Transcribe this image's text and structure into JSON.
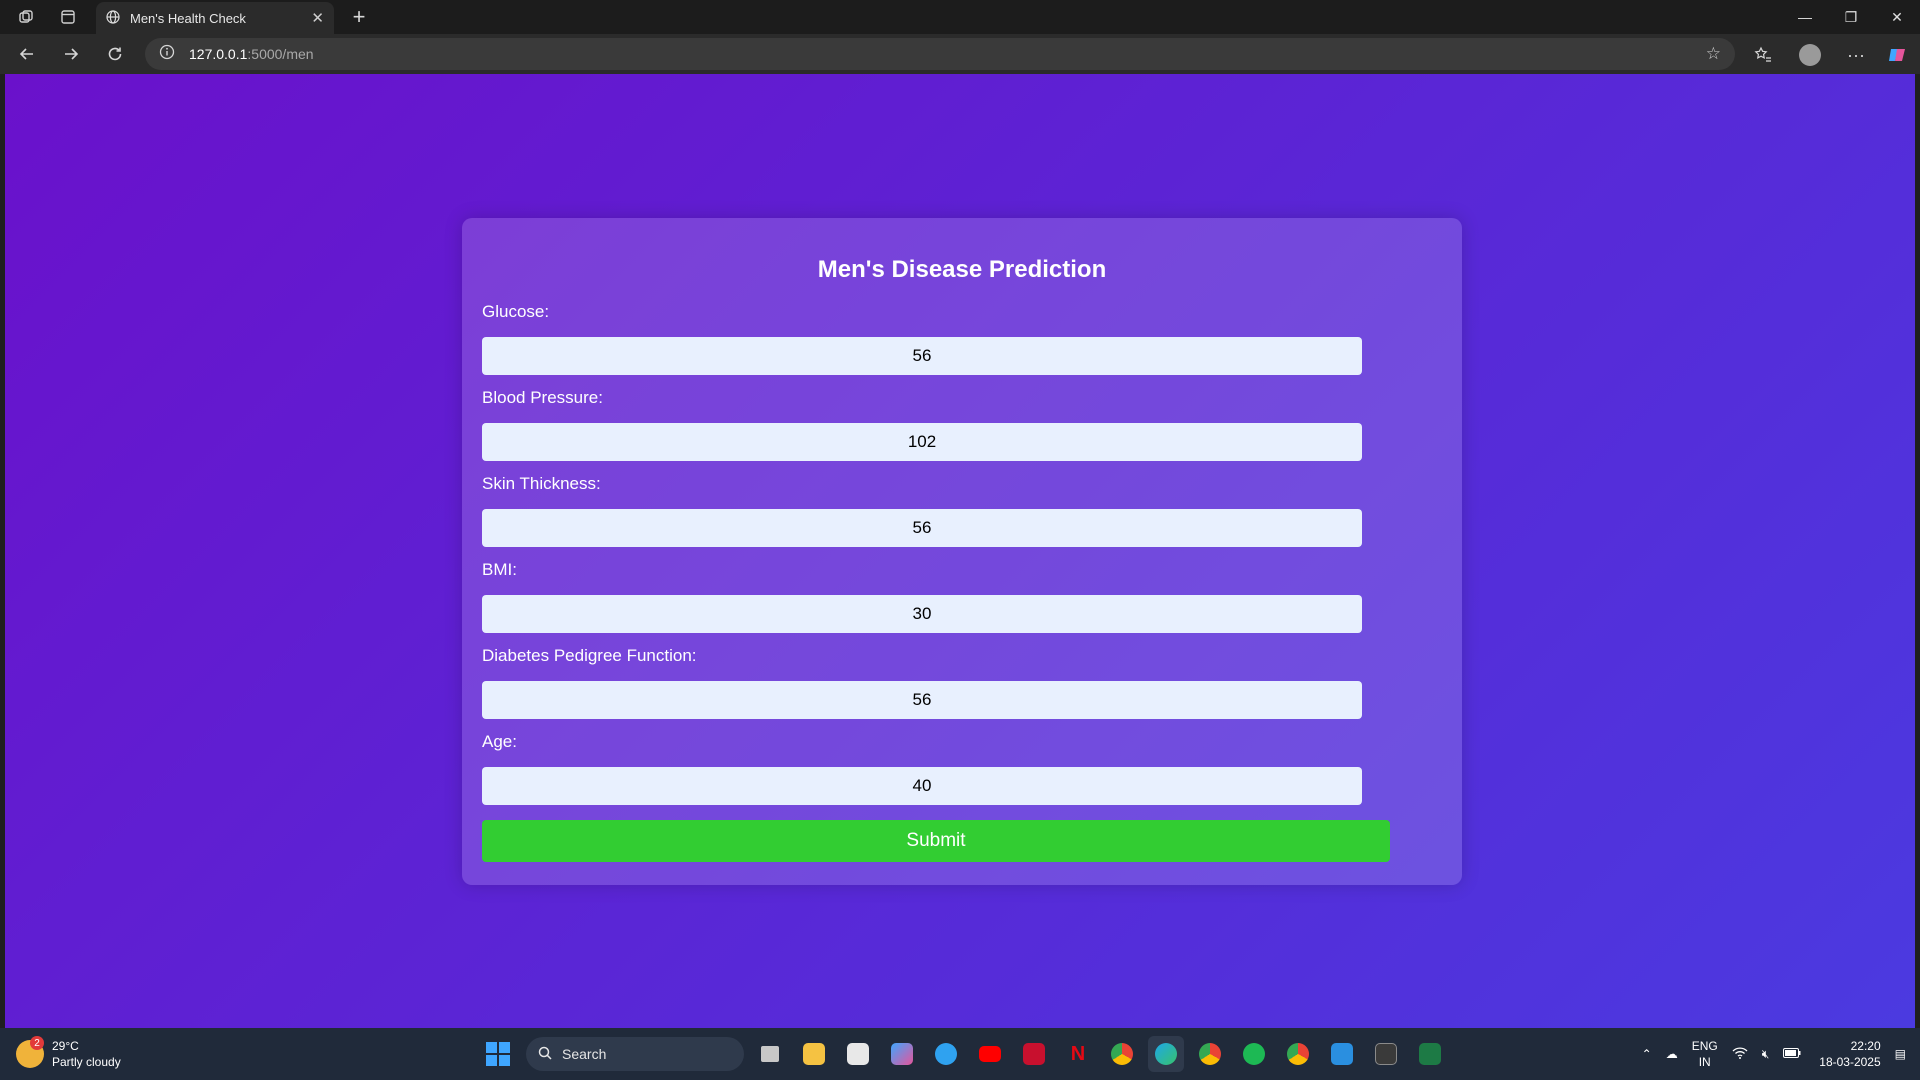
{
  "browser": {
    "tab_title": "Men's Health Check",
    "url_host": "127.0.0.1",
    "url_path": ":5000/men"
  },
  "page": {
    "title": "Men's Disease Prediction",
    "fields": [
      {
        "label": "Glucose:",
        "value": "56"
      },
      {
        "label": "Blood Pressure:",
        "value": "102"
      },
      {
        "label": "Skin Thickness:",
        "value": "56"
      },
      {
        "label": "BMI:",
        "value": "30"
      },
      {
        "label": "Diabetes Pedigree Function:",
        "value": "56"
      },
      {
        "label": "Age:",
        "value": "40"
      }
    ],
    "submit_label": "Submit"
  },
  "taskbar": {
    "weather_temp": "29°C",
    "weather_desc": "Partly cloudy",
    "weather_badge": "2",
    "search_label": "Search",
    "lang_top": "ENG",
    "lang_bottom": "IN",
    "time": "22:20",
    "date": "18-03-2025"
  },
  "colors": {
    "gradient_start": "#6a11cb",
    "gradient_end": "#4b3ae0",
    "submit_green": "#32cd32",
    "input_bg": "#e8f0fe"
  }
}
